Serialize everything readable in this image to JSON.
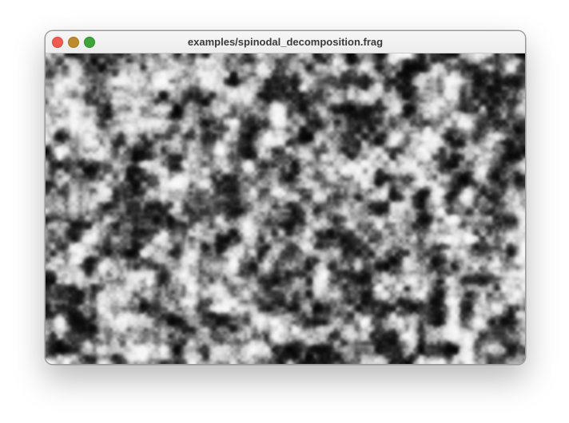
{
  "window": {
    "title": "examples/spinodal_decomposition.frag",
    "controls": {
      "close_color": "#ee5b52",
      "minimize_color": "#bd8a2e",
      "maximize_color": "#3ea43a"
    }
  },
  "canvas": {
    "content": "spinodal-decomposition-pattern",
    "colors": {
      "phase_a": "#000000",
      "phase_b": "#ffffff"
    }
  }
}
